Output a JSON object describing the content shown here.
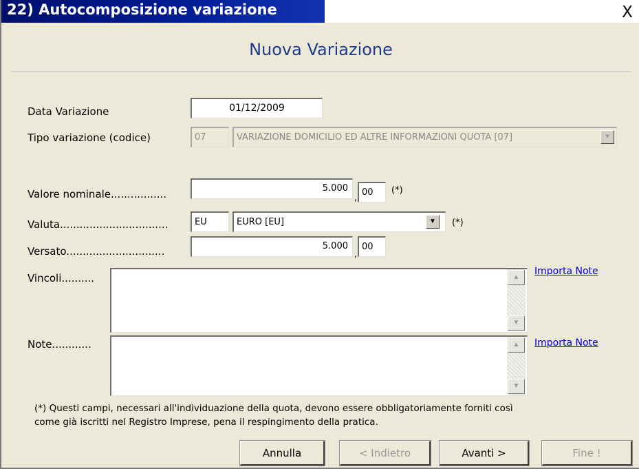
{
  "window": {
    "title": "22) Autocomposizione variazione",
    "close_glyph": "X"
  },
  "header": {
    "title": "Nuova Variazione"
  },
  "form": {
    "data_variazione": {
      "label": "Data Variazione",
      "value": "01/12/2009"
    },
    "tipo_variazione": {
      "label": "Tipo variazione (codice)",
      "code": "07",
      "selected": "VARIAZIONE DOMICILIO ED ALTRE INFORMAZIONI QUOTA [07]"
    },
    "valore_nominale": {
      "label": "Valore nominale.................",
      "integer": "5.000",
      "separator": ",",
      "decimal": "00",
      "required_mark": "(*)"
    },
    "valuta": {
      "label": "Valuta.................................",
      "code": "EU",
      "selected": "EURO [EU]",
      "required_mark": "(*)"
    },
    "versato": {
      "label": "Versato..............................",
      "integer": "5.000",
      "separator": ",",
      "decimal": "00"
    },
    "vincoli": {
      "label": "Vincoli..........",
      "value": "",
      "link": "Importa Note"
    },
    "note": {
      "label": "Note............",
      "value": "",
      "link": "Importa Note"
    }
  },
  "footnote": {
    "line1": "(*) Questi campi, necessari all'individuazione della quota, devono essere obbligatoriamente forniti così",
    "line2": "come già iscritti nel Registro Imprese, pena il respingimento della pratica."
  },
  "buttons": {
    "annulla": "Annulla",
    "indietro": "< Indietro",
    "avanti": "Avanti >",
    "fine": "Fine !"
  },
  "icons": {
    "dropdown": "chevron-down-icon",
    "scroll_up": "arrow-up-icon",
    "scroll_down": "arrow-down-icon",
    "close": "close-icon"
  },
  "colors": {
    "titlebar": "#00106b",
    "header_title": "#1e3a8a",
    "dialog_bg": "#ece9d8",
    "link": "#0000cc"
  }
}
